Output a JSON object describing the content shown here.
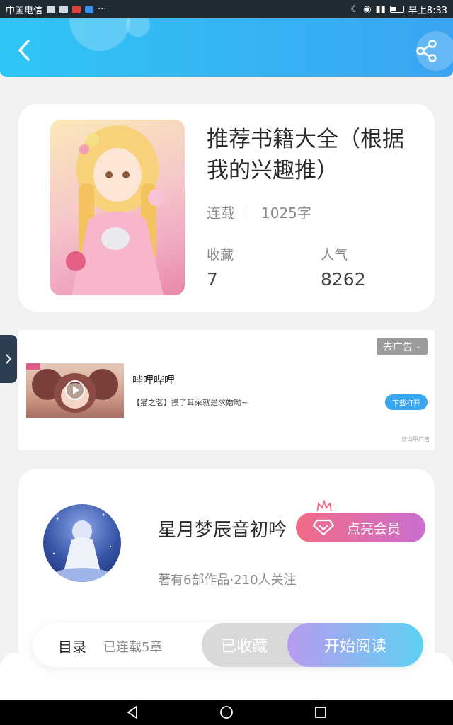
{
  "status_bar": {
    "carrier": "中国电信",
    "dots": "···",
    "time": "早上8:33"
  },
  "header": {
    "back_icon": "chevron-left-icon",
    "share_icon": "share-icon"
  },
  "book": {
    "title": "推荐书籍大全（根据我的兴趣推）",
    "status": "连载",
    "word_count": "1025字",
    "favorites_label": "收藏",
    "favorites_value": "7",
    "popularity_label": "人气",
    "popularity_value": "8262"
  },
  "ad": {
    "close_label": "去广告",
    "title": "哔哩哔哩",
    "description": "【猫之茗】摸了耳朵就是求婚呦~",
    "button_label": "下载打开",
    "source": "穿山甲广告"
  },
  "author": {
    "name": "星月梦辰音初吟",
    "vip_label": "点亮会员",
    "info": "著有6部作品·210人关注"
  },
  "action_bar": {
    "toc_label": "目录",
    "toc_sub": "已连载5章",
    "favorited_label": "已收藏",
    "read_label": "开始阅读"
  },
  "colors": {
    "header_start": "#2fc6f5",
    "header_end": "#3aa4f3",
    "vip_start": "#f26b84",
    "vip_end": "#c96fd0",
    "read_start": "#b89bf0",
    "read_end": "#5ed1f3"
  }
}
